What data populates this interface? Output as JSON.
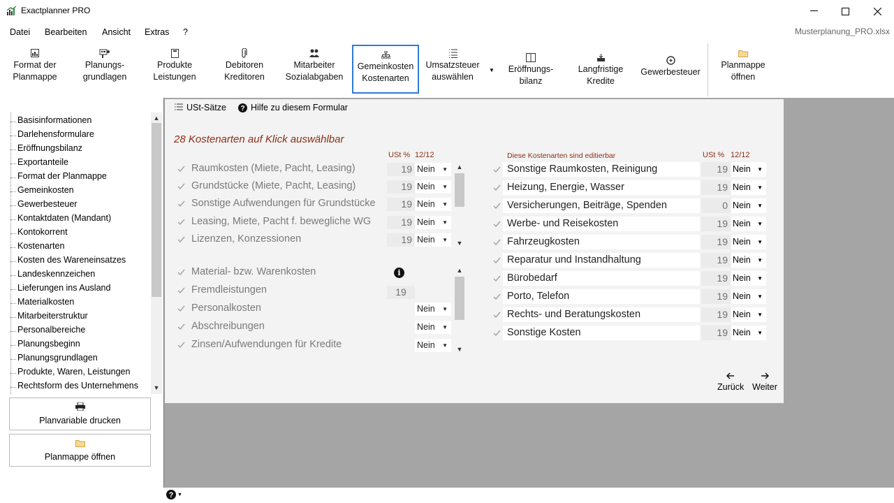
{
  "window": {
    "title": "Exactplanner PRO",
    "file": "Musterplanung_PRO.xlsx"
  },
  "menu": [
    "Datei",
    "Bearbeiten",
    "Ansicht",
    "Extras",
    "?"
  ],
  "ribbon": [
    {
      "l1": "Format der",
      "l2": "Planmappe",
      "icon": "format-icon"
    },
    {
      "l1": "Planungs-",
      "l2": "grundlagen",
      "icon": "basics-icon"
    },
    {
      "l1": "Produkte",
      "l2": "Leistungen",
      "icon": "products-icon"
    },
    {
      "l1": "Debitoren",
      "l2": "Kreditoren",
      "icon": "paperclip-icon"
    },
    {
      "l1": "Mitarbeiter",
      "l2": "Sozialabgaben",
      "icon": "people-icon"
    },
    {
      "l1": "Gemeinkosten",
      "l2": "Kostenarten",
      "icon": "hierarchy-icon"
    },
    {
      "l1": "Umsatzsteuer",
      "l2": "auswählen",
      "icon": "list-icon"
    },
    {
      "l1": "Eröffnungs-",
      "l2": "bilanz",
      "icon": "balance-icon"
    },
    {
      "l1": "Langfristige",
      "l2": "Kredite",
      "icon": "loan-icon"
    },
    {
      "l1": "Gewerbesteuer",
      "l2": "",
      "icon": "tax-icon"
    },
    {
      "l1": "Planmappe",
      "l2": "öffnen",
      "icon": "folder-icon"
    }
  ],
  "tree": [
    "Basisinformationen",
    "Darlehensformulare",
    "Eröffnungsbilanz",
    "Exportanteile",
    "Format der Planmappe",
    "Gemeinkosten",
    "Gewerbesteuer",
    "Kontaktdaten (Mandant)",
    "Kontokorrent",
    "Kostenarten",
    "Kosten des Wareneinsatzes",
    "Landeskennzeichen",
    "Lieferungen ins Ausland",
    "Materialkosten",
    "Mitarbeiterstruktur",
    "Personalbereiche",
    "Planungsbeginn",
    "Planungsgrundlagen",
    "Produkte, Waren, Leistungen",
    "Rechtsform des Unternehmens"
  ],
  "side_buttons": {
    "print": "Planvariable drucken",
    "open": "Planmappe öffnen"
  },
  "form": {
    "toolbar_ust": "USt-Sätze",
    "toolbar_help": "Hilfe zu diesem Formular",
    "title": "28 Kostenarten auf Klick auswählbar",
    "col_ust": "USt %",
    "col_1212": "12/12",
    "right_head": "Diese Kostenarten sind editierbar",
    "info_glyph": "i",
    "left_group1": [
      {
        "label": "Raumkosten (Miete, Pacht, Leasing)",
        "ust": "19",
        "sel": "Nein"
      },
      {
        "label": "Grundstücke (Miete, Pacht, Leasing)",
        "ust": "19",
        "sel": "Nein"
      },
      {
        "label": "Sonstige Aufwendungen für Grundstücke",
        "ust": "19",
        "sel": "Nein"
      },
      {
        "label": "Leasing, Miete, Pacht f. bewegliche WG",
        "ust": "19",
        "sel": "Nein"
      },
      {
        "label": "Lizenzen, Konzessionen",
        "ust": "19",
        "sel": "Nein"
      }
    ],
    "left_group2": [
      {
        "label": "Material- bzw. Warenkosten",
        "ust": "",
        "sel": ""
      },
      {
        "label": "Fremdleistungen",
        "ust": "19",
        "sel": ""
      },
      {
        "label": "Personalkosten",
        "ust": "",
        "sel": "Nein"
      },
      {
        "label": "Abschreibungen",
        "ust": "",
        "sel": "Nein"
      },
      {
        "label": "Zinsen/Aufwendungen für Kredite",
        "ust": "",
        "sel": "Nein"
      }
    ],
    "right_rows": [
      {
        "label": "Sonstige Raumkosten, Reinigung",
        "ust": "19",
        "sel": "Nein"
      },
      {
        "label": "Heizung, Energie, Wasser",
        "ust": "19",
        "sel": "Nein"
      },
      {
        "label": "Versicherungen, Beiträge, Spenden",
        "ust": "0",
        "sel": "Nein"
      },
      {
        "label": "Werbe- und Reisekosten",
        "ust": "19",
        "sel": "Nein"
      },
      {
        "label": "Fahrzeugkosten",
        "ust": "19",
        "sel": "Nein"
      },
      {
        "label": "Reparatur und Instandhaltung",
        "ust": "19",
        "sel": "Nein"
      },
      {
        "label": "Bürobedarf",
        "ust": "19",
        "sel": "Nein"
      },
      {
        "label": "Porto, Telefon",
        "ust": "19",
        "sel": "Nein"
      },
      {
        "label": "Rechts- und Beratungskosten",
        "ust": "19",
        "sel": "Nein"
      },
      {
        "label": "Sonstige Kosten",
        "ust": "19",
        "sel": "Nein"
      }
    ],
    "back": "Zurück",
    "next": "Weiter"
  },
  "colors": {
    "accent": "#2d7ad6",
    "title_red": "#8b2e16",
    "workspace": "#a5a5a5"
  }
}
